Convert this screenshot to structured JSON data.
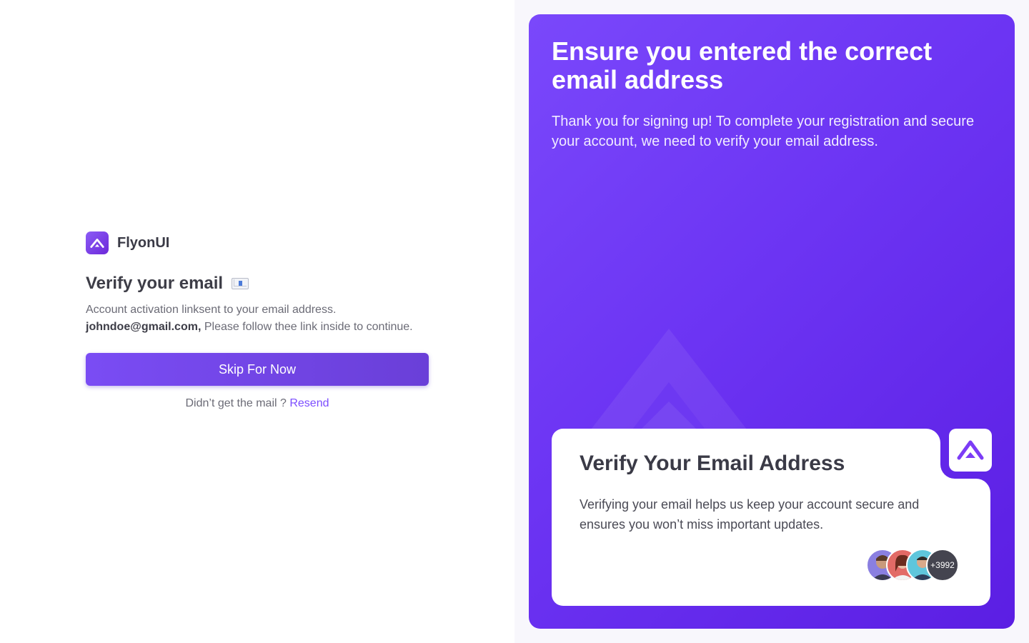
{
  "brand": {
    "name": "FlyonUI",
    "logo_icon": "flyonui-logo-icon"
  },
  "verify": {
    "title": "Verify your email",
    "title_icon": "envelope-icon",
    "line1": "Account activation linksent to your email address.",
    "email": "johndoe@gmail.com,",
    "line2": "Please follow thee link inside to continue.",
    "skip_label": "Skip For Now",
    "resend_prompt": "Didn’t get the mail ?",
    "resend_label": "Resend"
  },
  "panel": {
    "title": "Ensure you entered the correct email address",
    "text": "Thank you for signing up! To complete your registration and secure your account, we need to verify your email address.",
    "card": {
      "title": "Verify Your Email Address",
      "text": "Verifying your email helps us keep your account secure and ensures you won’t miss important updates.",
      "more_count": "+3992"
    }
  },
  "colors": {
    "primary": "#7c4dff",
    "panel_start": "#7a48fb",
    "panel_end": "#5b1ee3",
    "heading": "#3d3d47"
  }
}
